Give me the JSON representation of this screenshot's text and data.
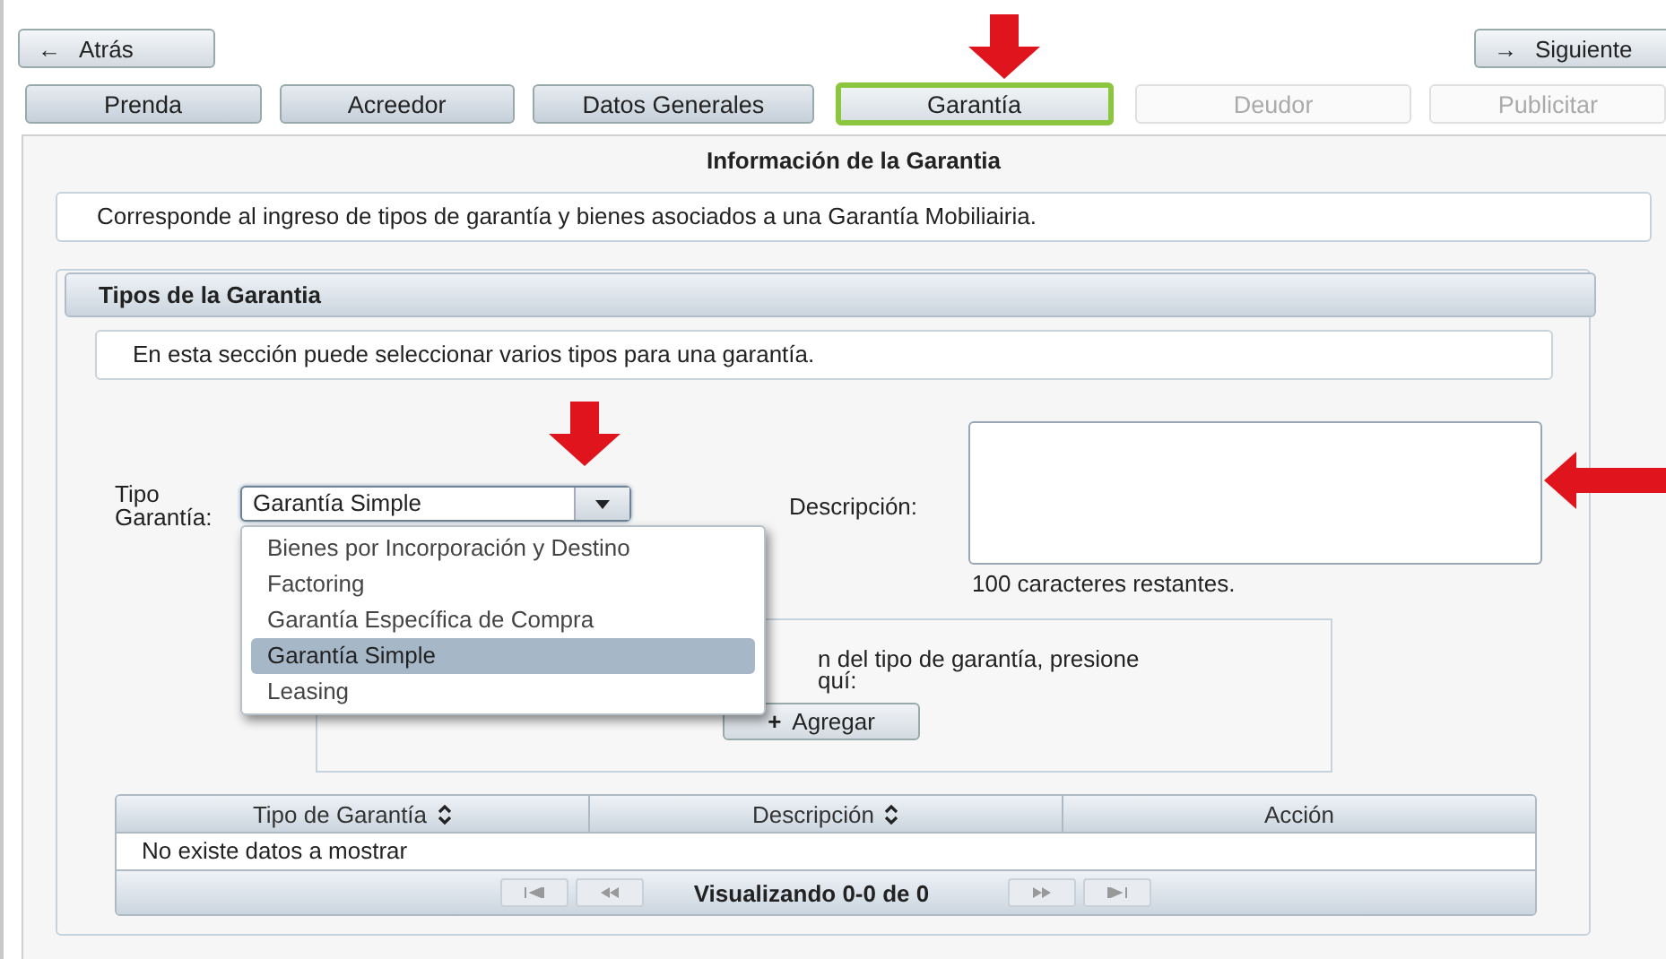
{
  "nav": {
    "back": {
      "icon": "←",
      "label": "Atrás"
    },
    "next": {
      "icon": "→",
      "label": "Siguiente"
    }
  },
  "tabs": [
    {
      "label": "Prenda",
      "selected": false,
      "disabled": false
    },
    {
      "label": "Acreedor",
      "selected": false,
      "disabled": false
    },
    {
      "label": "Datos Generales",
      "selected": false,
      "disabled": false
    },
    {
      "label": "Garantía",
      "selected": true,
      "disabled": false
    },
    {
      "label": "Deudor",
      "selected": false,
      "disabled": true
    },
    {
      "label": "Publicitar",
      "selected": false,
      "disabled": true
    }
  ],
  "panel": {
    "title": "Información de la Garantia",
    "intro": "Corresponde al ingreso de tipos de garantía y bienes asociados a una Garantía Mobiliairia.",
    "section": {
      "title": "Tipos de la Garantia",
      "note": "En esta sección puede seleccionar varios tipos para una garantía.",
      "type_field": {
        "label": "Tipo Garantía:",
        "value": "Garantía Simple",
        "expanded": true,
        "options": [
          {
            "label": "Bienes por Incorporación y Destino",
            "selected": false
          },
          {
            "label": "Factoring",
            "selected": false
          },
          {
            "label": "Garantía Específica de Compra",
            "selected": false
          },
          {
            "label": "Garantía Simple",
            "selected": true
          },
          {
            "label": "Leasing",
            "selected": false
          }
        ]
      },
      "description": {
        "label": "Descripción:",
        "remaining": "100 caracteres restantes."
      },
      "add_box": {
        "text_lines": [
          "n del tipo de garantía, presione",
          "quí:"
        ],
        "button": {
          "icon": "+",
          "label": "Agregar"
        }
      },
      "table": {
        "columns": [
          {
            "label": "Tipo de Garantía",
            "sortable": true
          },
          {
            "label": "Descripción",
            "sortable": true
          },
          {
            "label": "Acción",
            "sortable": false
          }
        ],
        "empty_message": "No existe datos a mostrar",
        "pager": "Visualizando 0-0 de 0"
      }
    }
  },
  "annotations": [
    {
      "kind": "down"
    },
    {
      "kind": "down"
    },
    {
      "kind": "left"
    }
  ]
}
